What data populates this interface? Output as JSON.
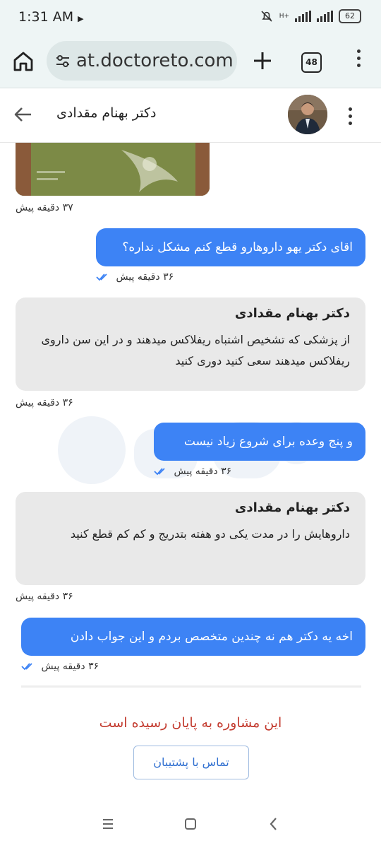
{
  "status_bar": {
    "time": "1:31 AM",
    "battery": "62",
    "network": "H+"
  },
  "browser": {
    "url": "at.doctoreto.com",
    "tab_count": "48"
  },
  "chat_header": {
    "doctor_name": "دکتر بهنام مقدادی"
  },
  "messages": [
    {
      "type": "image",
      "time": "۳۷ دقیقه پیش"
    },
    {
      "type": "outgoing",
      "text": "اقای دکتر یهو داروهارو قطع کنم مشکل نداره؟",
      "time": "۳۶ دقیقه پیش"
    },
    {
      "type": "incoming",
      "sender": "دکتر بهنام مقدادی",
      "text": "از پزشکی که تشخیص اشتباه ریفلاکس میدهند و در این سن داروی ریفلاکس میدهند سعی کنید دوری کنید",
      "time": "۳۶ دقیقه پیش"
    },
    {
      "type": "outgoing",
      "text": "و پنج وعده برای شروع زیاد نیست",
      "time": "۳۶ دقیقه پیش"
    },
    {
      "type": "incoming",
      "sender": "دکتر بهنام مقدادی",
      "text": "داروهایش را در مدت یکی دو هفته بتدریج و کم کم قطع کنید",
      "time": "۳۶ دقیقه پیش"
    },
    {
      "type": "outgoing",
      "text": "اخه یه دکتر هم نه چندین متخصص بردم و این جواب دادن",
      "time": "۳۶ دقیقه پیش"
    }
  ],
  "footer": {
    "ended_text": "این مشاوره به پایان رسیده است",
    "support_button": "تماس با پشتیبان"
  }
}
